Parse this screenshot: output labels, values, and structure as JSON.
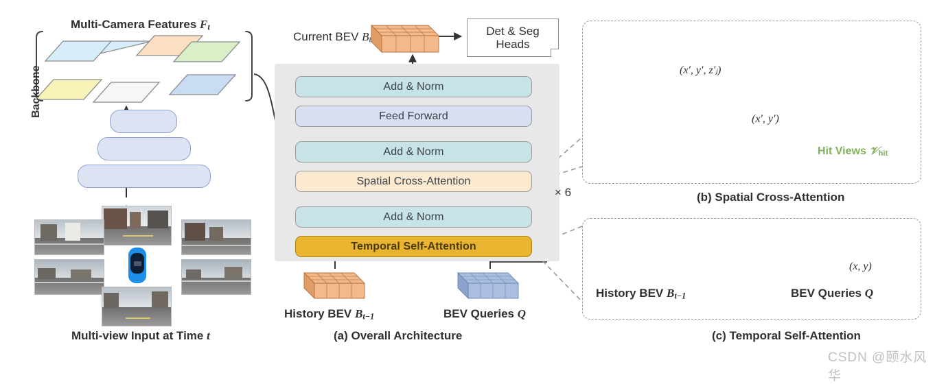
{
  "figure": {
    "watermark": "CSDN @颐水风华"
  },
  "left": {
    "features_title": "Multi-Camera Features",
    "features_title_sym": "F",
    "features_title_sub": "t",
    "backbone_label": "Backbone",
    "input_caption_pre": "Multi-view Input at Time ",
    "input_caption_sym": "t",
    "feature_planes": [
      {
        "name": "plane-cyan",
        "color": "#d6eefa"
      },
      {
        "name": "plane-orange",
        "color": "#fae0c0"
      },
      {
        "name": "plane-green",
        "color": "#d8efc8"
      },
      {
        "name": "plane-yellow",
        "color": "#faf3b8"
      },
      {
        "name": "plane-white",
        "color": "#f6f6f6"
      },
      {
        "name": "plane-blue",
        "color": "#c9dcf4"
      }
    ],
    "backbone_bars": 3,
    "camera_views": 6
  },
  "center": {
    "caption": "(a) Overall Architecture",
    "current_bev_label": "Current BEV",
    "current_bev_sym": "B",
    "current_bev_sub": "t",
    "heads_line1": "Det & Seg",
    "heads_line2": "Heads",
    "repeat_label": "× 6",
    "blocks": [
      {
        "label": "Add & Norm",
        "kind": "addnorm"
      },
      {
        "label": "Feed Forward",
        "kind": "ff"
      },
      {
        "label": "Add & Norm",
        "kind": "addnorm"
      },
      {
        "label": "Spatial Cross-Attention",
        "kind": "sca"
      },
      {
        "label": "Add & Norm",
        "kind": "addnorm"
      },
      {
        "label": "Temporal Self-Attention",
        "kind": "tsa"
      }
    ],
    "history_bev_label": "History BEV",
    "history_bev_sym": "B",
    "history_bev_sub": "t−1",
    "bev_queries_label": "BEV Queries",
    "bev_queries_sym": "Q"
  },
  "panel_b": {
    "caption": "(b) Spatial Cross-Attention",
    "pillar_label": "(x′, y′, z′ⱼ)",
    "cell_label": "(x′, y′)",
    "hit_views_label": "Hit Views",
    "hit_views_sym": "𝒱",
    "hit_views_sub": "hit",
    "planes": [
      {
        "name": "plane-cyan",
        "color": "#d6eefa"
      },
      {
        "name": "plane-orange",
        "color": "#fae0c0"
      },
      {
        "name": "plane-yellow",
        "color": "#faf3b8"
      },
      {
        "name": "plane-white",
        "color": "#f6f6f6"
      },
      {
        "name": "plane-green-hit",
        "color": "#d8efc8"
      },
      {
        "name": "plane-blue-hit",
        "color": "#c9dcf4"
      }
    ]
  },
  "panel_c": {
    "caption": "(c) Temporal Self-Attention",
    "history_bev_label": "History BEV",
    "history_bev_sym": "B",
    "history_bev_sub": "t−1",
    "bev_queries_label": "BEV Queries",
    "bev_queries_sym": "Q",
    "cell_label": "(x, y)"
  },
  "colors": {
    "bev_orange": "#f3b98a",
    "bev_blue": "#aabfe0",
    "bev_highlight": "#fade8f",
    "panel_gray": "#e8e8e8",
    "accent_yellow": "#e9b430",
    "hit_green": "#7fb05b",
    "marker_red": "#e23b2e"
  }
}
